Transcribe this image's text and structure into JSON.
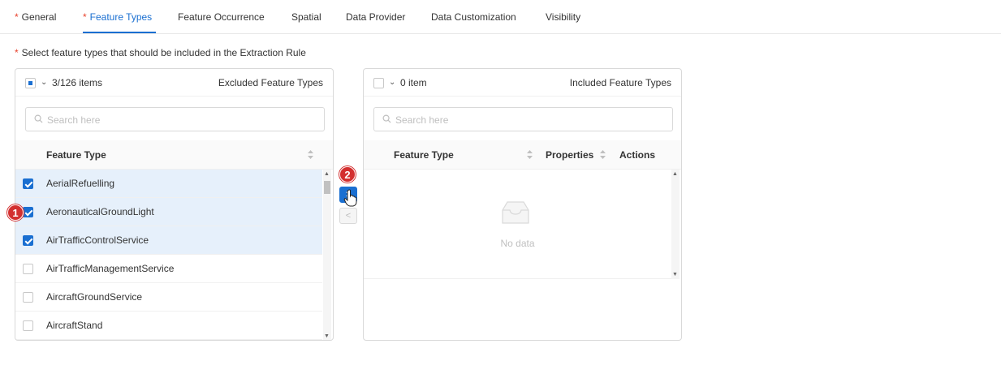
{
  "tabs": [
    {
      "label": "General",
      "required": true
    },
    {
      "label": "Feature Types",
      "required": true
    },
    {
      "label": "Feature Occurrence",
      "required": false
    },
    {
      "label": "Spatial",
      "required": false
    },
    {
      "label": "Data Provider",
      "required": false
    },
    {
      "label": "Data Customization",
      "required": false
    },
    {
      "label": "Visibility",
      "required": false
    }
  ],
  "active_tab": "Feature Types",
  "instruction": "Select feature types that should be included in the Extraction Rule",
  "required_mark": "*",
  "left_panel": {
    "count": "3/126 items",
    "title": "Excluded Feature Types",
    "search_placeholder": "Search here",
    "column": "Feature Type",
    "rows": [
      {
        "label": "AerialRefuelling",
        "checked": true
      },
      {
        "label": "AeronauticalGroundLight",
        "checked": true
      },
      {
        "label": "AirTrafficControlService",
        "checked": true
      },
      {
        "label": "AirTrafficManagementService",
        "checked": false
      },
      {
        "label": "AircraftGroundService",
        "checked": false
      },
      {
        "label": "AircraftStand",
        "checked": false
      }
    ]
  },
  "right_panel": {
    "count": "0 item",
    "title": "Included Feature Types",
    "search_placeholder": "Search here",
    "columns": [
      "Feature Type",
      "Properties",
      "Actions"
    ],
    "empty_text": "No data"
  },
  "operations": {
    "move_right": ">",
    "move_left": "<"
  },
  "annotations": [
    "1",
    "2"
  ],
  "colors": {
    "accent": "#1a6fd1",
    "required": "#e8412c",
    "annotation": "#d32f2f",
    "selected_row": "#e6f0fb"
  }
}
